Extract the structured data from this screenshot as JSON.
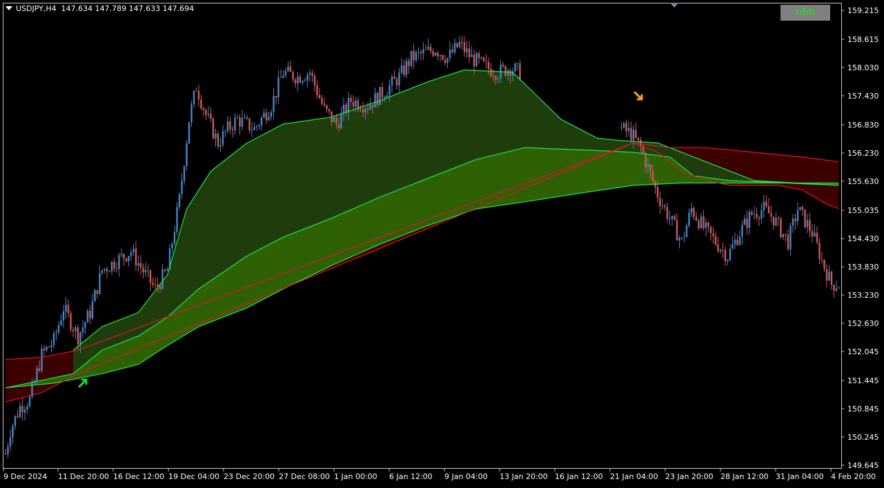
{
  "header": {
    "symbol": "USDJPY,H4",
    "ohlc": "147.634 147.789 147.633 147.694"
  },
  "ribbon_button": {
    "label": "ribb"
  },
  "colors": {
    "background": "#000000",
    "bull_candle": "#4a86c8",
    "bear_candle": "#d05a5a",
    "ribbon_dark_green": "#1f3d0c",
    "ribbon_green": "#2e6104",
    "ribbon_red": "#3d0000",
    "ribbon_line_green": "#1de94d",
    "ribbon_line_red": "#e0142b",
    "arrow_up": "#2ad62a",
    "arrow_down": "#f5a623"
  },
  "chart_data": {
    "type": "candlestick",
    "title": "USDJPY,H4",
    "ylim": [
      149.645,
      159.215
    ],
    "y_ticks": [
      "159.215",
      "158.615",
      "158.030",
      "157.430",
      "156.830",
      "156.230",
      "155.630",
      "155.035",
      "154.430",
      "153.830",
      "153.230",
      "152.630",
      "152.045",
      "151.445",
      "150.845",
      "150.245",
      "149.645"
    ],
    "x_ticks": [
      "9 Dec 2024",
      "11 Dec 20:00",
      "16 Dec 12:00",
      "19 Dec 04:00",
      "23 Dec 20:00",
      "27 Dec 08:00",
      "1 Jan 00:00",
      "6 Jan 12:00",
      "9 Jan 04:00",
      "13 Jan 20:00",
      "16 Jan 12:00",
      "21 Jan 04:00",
      "23 Jan 20:00",
      "28 Jan 12:00",
      "31 Jan 04:00",
      "4 Feb 20:00"
    ],
    "close_path": [
      [
        0,
        149.8
      ],
      [
        2,
        150.3
      ],
      [
        6,
        150.8
      ],
      [
        10,
        150.95
      ],
      [
        15,
        151.9
      ],
      [
        20,
        152.2
      ],
      [
        24,
        152.9
      ],
      [
        30,
        152.3
      ],
      [
        35,
        152.8
      ],
      [
        40,
        153.7
      ],
      [
        46,
        153.9
      ],
      [
        52,
        154.1
      ],
      [
        58,
        153.6
      ],
      [
        62,
        153.3
      ],
      [
        67,
        153.7
      ],
      [
        72,
        155.2
      ],
      [
        76,
        156.9
      ],
      [
        79,
        157.6
      ],
      [
        83,
        157.0
      ],
      [
        88,
        156.4
      ],
      [
        92,
        156.7
      ],
      [
        96,
        156.9
      ],
      [
        103,
        156.7
      ],
      [
        110,
        157.2
      ],
      [
        115,
        157.9
      ],
      [
        121,
        157.8
      ],
      [
        126,
        157.9
      ],
      [
        132,
        157.1
      ],
      [
        137,
        156.8
      ],
      [
        143,
        157.3
      ],
      [
        150,
        157.2
      ],
      [
        157,
        157.5
      ],
      [
        163,
        157.8
      ],
      [
        168,
        158.2
      ],
      [
        173,
        158.3
      ],
      [
        178,
        158.4
      ],
      [
        183,
        158.2
      ],
      [
        188,
        158.5
      ],
      [
        193,
        158.2
      ],
      [
        199,
        158.0
      ],
      [
        204,
        157.9
      ],
      [
        209,
        158.0
      ],
      [
        213,
        157.9
      ],
      [
        255,
        156.7
      ],
      [
        259,
        156.6
      ],
      [
        263,
        156.3
      ],
      [
        270,
        155.3
      ],
      [
        276,
        154.7
      ],
      [
        280,
        154.3
      ],
      [
        284,
        155.0
      ],
      [
        289,
        154.6
      ],
      [
        294,
        154.3
      ],
      [
        299,
        154.0
      ],
      [
        304,
        154.5
      ],
      [
        309,
        154.9
      ],
      [
        314,
        155.0
      ],
      [
        318,
        154.8
      ],
      [
        324,
        154.3
      ],
      [
        328,
        155.0
      ],
      [
        334,
        154.5
      ],
      [
        338,
        153.9
      ],
      [
        342,
        153.4
      ]
    ],
    "ribbon_dark_green_top": [
      [
        28,
        152.0
      ],
      [
        40,
        152.5
      ],
      [
        55,
        152.8
      ],
      [
        67,
        153.6
      ],
      [
        75,
        155.0
      ],
      [
        85,
        155.8
      ],
      [
        100,
        156.4
      ],
      [
        115,
        156.8
      ],
      [
        135,
        156.95
      ],
      [
        155,
        157.3
      ],
      [
        175,
        157.7
      ],
      [
        190,
        157.95
      ],
      [
        210,
        157.9
      ],
      [
        220,
        157.4
      ],
      [
        230,
        156.9
      ],
      [
        245,
        156.5
      ],
      [
        255,
        156.45
      ],
      [
        270,
        156.4
      ],
      [
        290,
        156.0
      ],
      [
        310,
        155.6
      ],
      [
        345,
        155.5
      ]
    ],
    "ribbon_mid": [
      [
        0,
        151.2
      ],
      [
        28,
        151.5
      ],
      [
        40,
        152.0
      ],
      [
        55,
        152.3
      ],
      [
        67,
        152.7
      ],
      [
        80,
        153.3
      ],
      [
        100,
        154.0
      ],
      [
        115,
        154.4
      ],
      [
        135,
        154.8
      ],
      [
        155,
        155.25
      ],
      [
        175,
        155.65
      ],
      [
        195,
        156.05
      ],
      [
        215,
        156.3
      ],
      [
        240,
        156.25
      ],
      [
        260,
        156.2
      ],
      [
        275,
        156.1
      ],
      [
        285,
        155.7
      ],
      [
        300,
        155.6
      ],
      [
        345,
        155.5
      ]
    ],
    "ribbon_bottom": [
      [
        0,
        151.2
      ],
      [
        20,
        151.3
      ],
      [
        40,
        151.5
      ],
      [
        55,
        151.7
      ],
      [
        67,
        152.1
      ],
      [
        80,
        152.5
      ],
      [
        100,
        152.9
      ],
      [
        115,
        153.3
      ],
      [
        135,
        153.8
      ],
      [
        155,
        154.25
      ],
      [
        175,
        154.65
      ],
      [
        195,
        155.0
      ],
      [
        215,
        155.15
      ],
      [
        240,
        155.35
      ],
      [
        260,
        155.5
      ],
      [
        280,
        155.55
      ],
      [
        300,
        155.55
      ],
      [
        345,
        155.55
      ]
    ],
    "ribbon_red_top": [
      [
        0,
        151.8
      ],
      [
        15,
        151.85
      ],
      [
        30,
        152.0
      ],
      [
        260,
        156.4
      ],
      [
        275,
        156.3
      ],
      [
        290,
        156.3
      ],
      [
        310,
        156.2
      ],
      [
        330,
        156.1
      ],
      [
        345,
        156.0
      ]
    ],
    "ribbon_red_bottom": [
      [
        0,
        150.9
      ],
      [
        15,
        151.1
      ],
      [
        30,
        151.5
      ],
      [
        260,
        156.4
      ],
      [
        270,
        156.2
      ],
      [
        280,
        155.8
      ],
      [
        290,
        155.6
      ],
      [
        300,
        155.5
      ],
      [
        320,
        155.5
      ],
      [
        330,
        155.4
      ],
      [
        340,
        155.1
      ],
      [
        345,
        155.0
      ]
    ],
    "signals": [
      {
        "type": "buy",
        "x": 32,
        "y": 151.3
      },
      {
        "type": "sell",
        "x": 262,
        "y": 157.4
      }
    ]
  }
}
